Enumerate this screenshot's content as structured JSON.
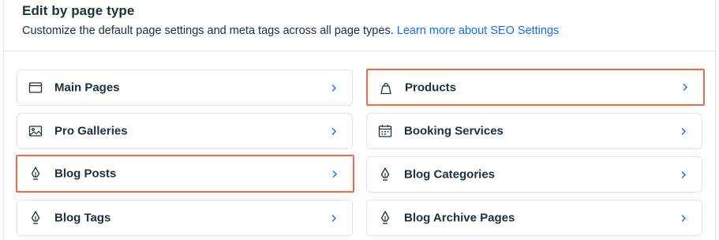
{
  "section": {
    "title": "Edit by page type",
    "description": "Customize the default page settings and meta tags across all page types.",
    "learn_more_link": "Learn more about SEO Settings"
  },
  "colors": {
    "link": "#116dff",
    "highlight": "#ef6a4b",
    "text": "#20303c",
    "border": "#dfe5eb"
  },
  "page_types": [
    {
      "label": "Main Pages",
      "icon": "page-window-icon",
      "highlighted": false
    },
    {
      "label": "Products",
      "icon": "shopping-bag-icon",
      "highlighted": true
    },
    {
      "label": "Pro Galleries",
      "icon": "gallery-icon",
      "highlighted": false
    },
    {
      "label": "Booking Services",
      "icon": "calendar-icon",
      "highlighted": false
    },
    {
      "label": "Blog Posts",
      "icon": "pen-nib-icon",
      "highlighted": true
    },
    {
      "label": "Blog Categories",
      "icon": "pen-nib-icon",
      "highlighted": false
    },
    {
      "label": "Blog Tags",
      "icon": "pen-nib-icon",
      "highlighted": false
    },
    {
      "label": "Blog Archive Pages",
      "icon": "pen-nib-icon",
      "highlighted": false
    }
  ]
}
